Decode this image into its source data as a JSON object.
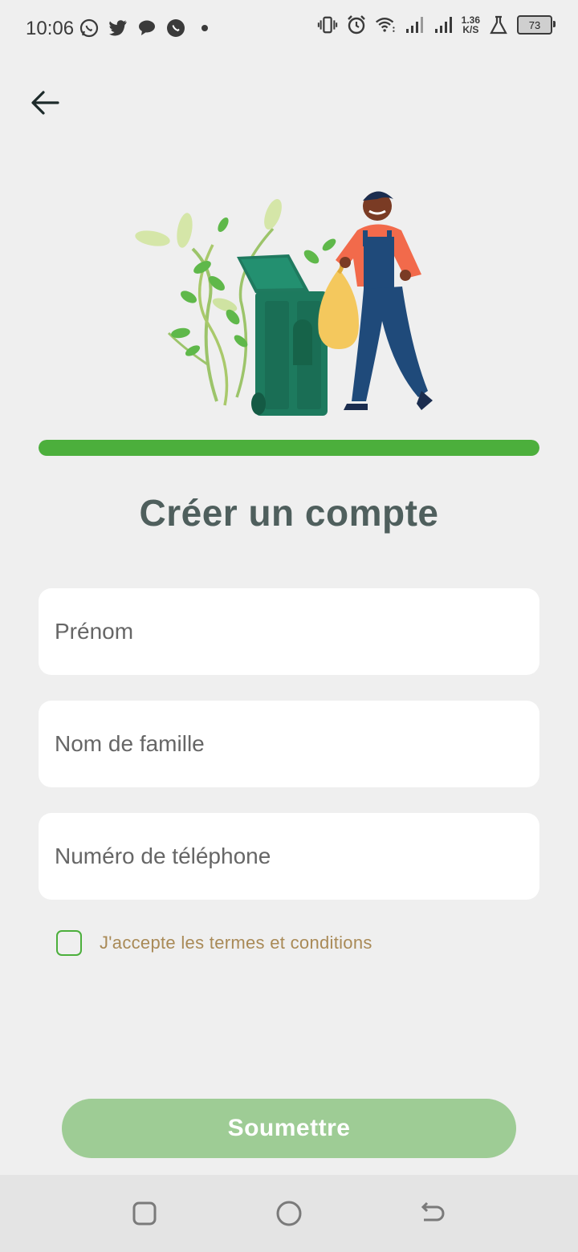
{
  "status_bar": {
    "time": "10:06",
    "net_speed_value": "1.36",
    "net_speed_unit": "K/S",
    "battery": "73",
    "left_icons": [
      "whatsapp-icon",
      "twitter-icon",
      "chat-bubble-icon",
      "whatsapp-icon",
      "dot-icon"
    ],
    "right_icons": [
      "vibrate-icon",
      "alarm-icon",
      "wifi-icon",
      "signal-icon",
      "signal-icon",
      "lab-flask-icon",
      "battery-icon"
    ]
  },
  "header": {
    "back_icon": "arrow-left-icon"
  },
  "progress": {
    "value": 1.0,
    "color": "#4CAF3C"
  },
  "title": "Créer un compte",
  "form": {
    "first_name_placeholder": "Prénom",
    "last_name_placeholder": "Nom de famille",
    "phone_placeholder": "Numéro de téléphone",
    "terms_label": "J'accepte les termes et conditions",
    "terms_checked": false
  },
  "submit_label": "Soumettre",
  "colors": {
    "accent": "#4CAF3C",
    "title": "#4F5F5D",
    "terms_text": "#A98A57",
    "submit_bg": "#9ECC95",
    "background": "#EFEFEF"
  },
  "nav_bar": {
    "icons": [
      "recent-apps-icon",
      "home-icon",
      "back-icon"
    ]
  }
}
